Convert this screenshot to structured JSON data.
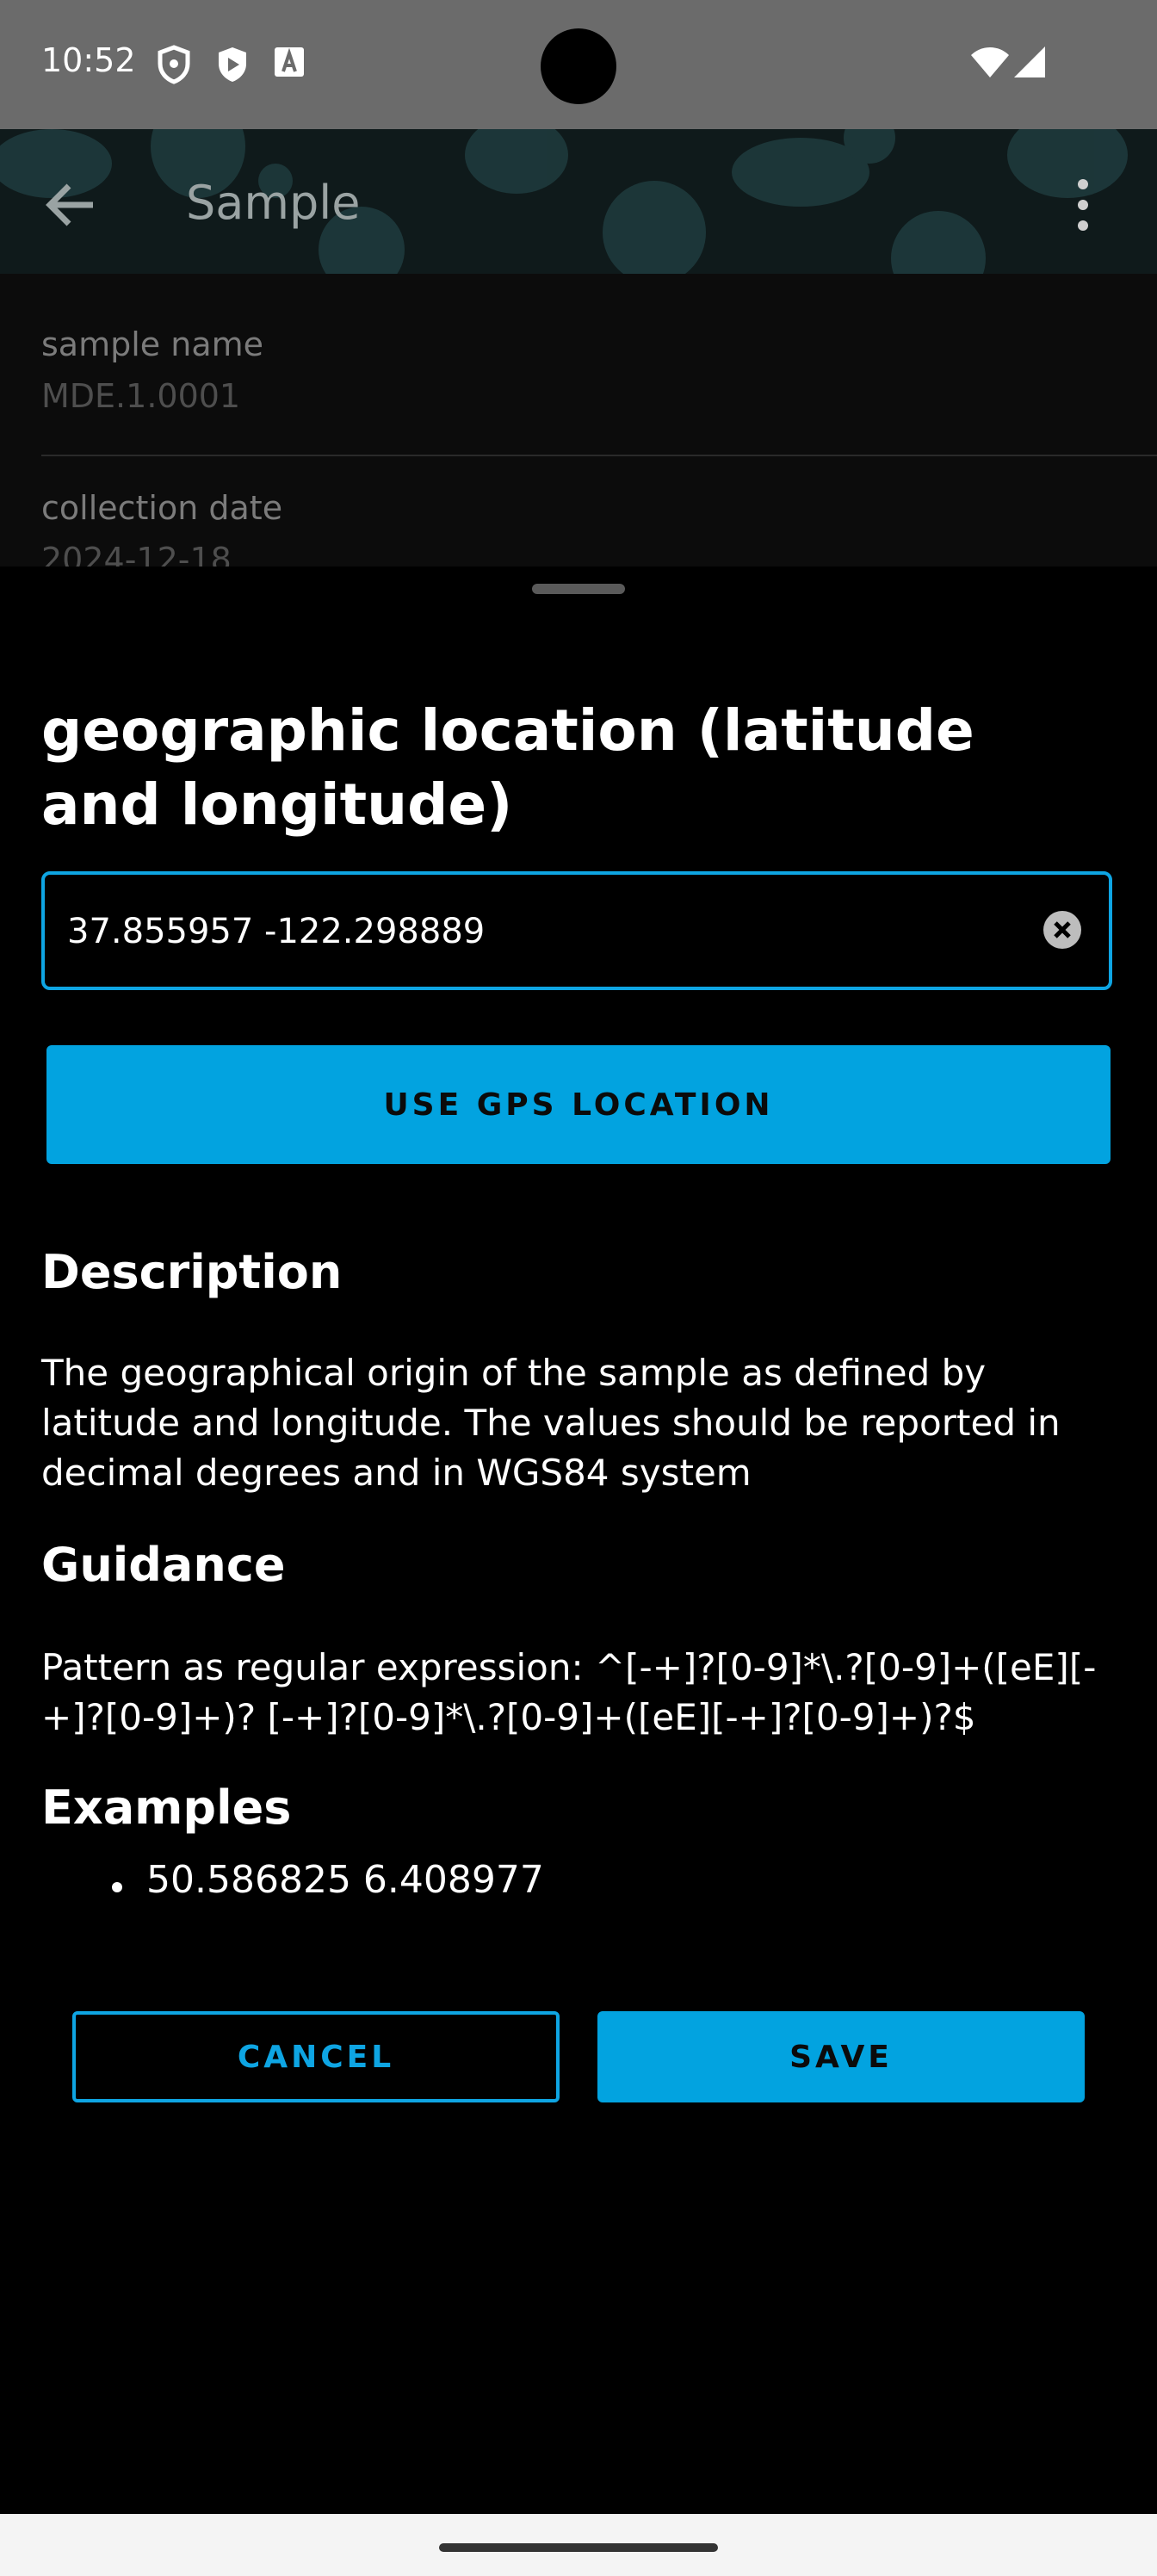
{
  "status_bar": {
    "time": "10:52"
  },
  "app_bar": {
    "title": "Sample"
  },
  "background_fields": [
    {
      "label": "sample name",
      "value": "MDE.1.0001"
    },
    {
      "label": "collection date",
      "value": "2024-12-18"
    }
  ],
  "sheet": {
    "title": "geographic location (latitude and longitude)",
    "input_value": "37.855957 -122.298889",
    "gps_button": "USE GPS LOCATION",
    "description_heading": "Description",
    "description_text": "The geographical origin of the sample as defined by latitude and longitude. The values should be reported in decimal degrees and in WGS84 system",
    "guidance_heading": "Guidance",
    "guidance_text": "Pattern as regular expression: ^[-+]?[0-9]*\\.?[0-9]+([eE][-+]?[0-9]+)? [-+]?[0-9]*\\.?[0-9]+([eE][-+]?[0-9]+)?$",
    "examples_heading": "Examples",
    "examples": [
      "50.586825 6.408977"
    ],
    "cancel_button": "CANCEL",
    "save_button": "SAVE"
  },
  "colors": {
    "accent": "#02a3e0",
    "background": "#000000"
  }
}
